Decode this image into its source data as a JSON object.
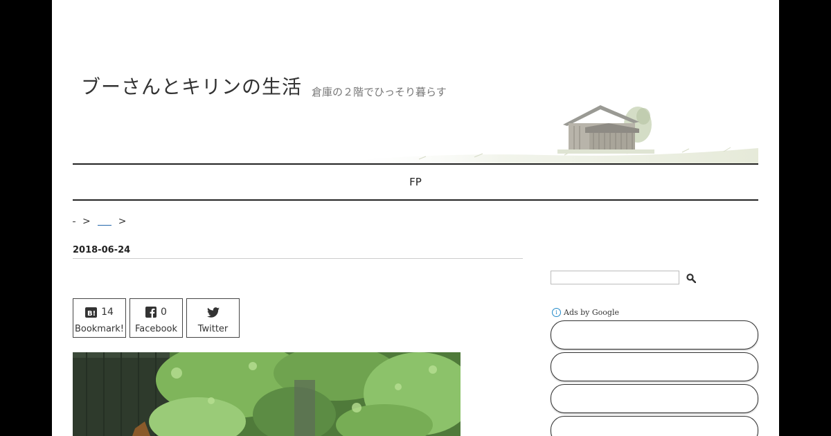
{
  "site": {
    "title": "ブーさんとキリンの生活",
    "description": "倉庫の２階でひっそり暮らす"
  },
  "nav": {
    "items": [
      "FP"
    ]
  },
  "breadcrumb": {
    "separator": ">"
  },
  "article": {
    "date": "2018-06-24"
  },
  "share": {
    "hatena": {
      "count": "14",
      "label": "Bookmark!",
      "icon": "hatena-bookmark-icon"
    },
    "facebook": {
      "count": "0",
      "label": "Facebook",
      "icon": "facebook-icon"
    },
    "twitter": {
      "label": "Twitter",
      "icon": "twitter-icon"
    }
  },
  "sidebar": {
    "search": {
      "placeholder": "",
      "icon": "search-icon"
    },
    "ads_label": "Ads by Google"
  },
  "colors": {
    "frame": "#000000",
    "page": "#ffffff",
    "text": "#222222",
    "link": "#2266aa",
    "ads_info": "#1e88c8"
  }
}
